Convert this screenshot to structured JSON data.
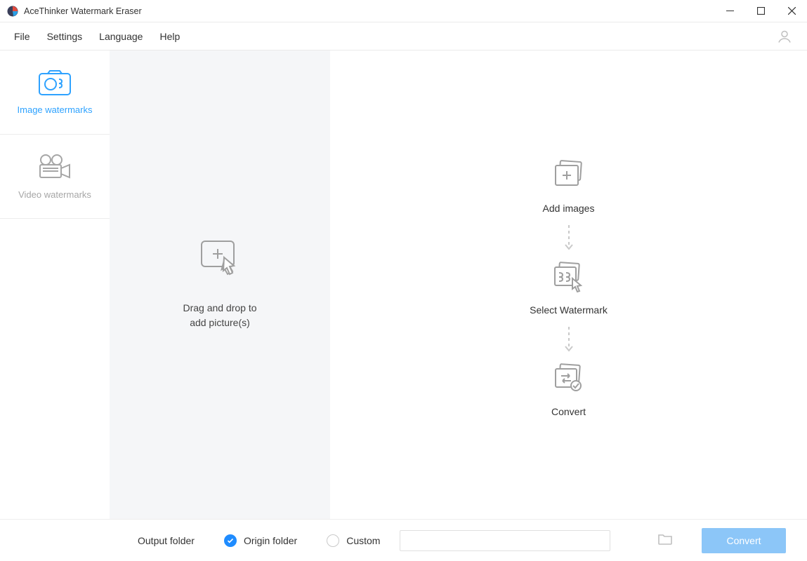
{
  "app": {
    "title": "AceThinker Watermark Eraser"
  },
  "menu": {
    "file": "File",
    "settings": "Settings",
    "language": "Language",
    "help": "Help"
  },
  "sidebar": {
    "image_watermarks": "Image watermarks",
    "video_watermarks": "Video watermarks"
  },
  "drop": {
    "line1": "Drag and drop to",
    "line2": "add picture(s)"
  },
  "steps": {
    "add_images": "Add images",
    "select_watermark": "Select Watermark",
    "convert": "Convert"
  },
  "footer": {
    "output_folder_label": "Output folder",
    "origin_folder": "Origin folder",
    "custom": "Custom",
    "custom_path": "",
    "convert_button": "Convert"
  }
}
